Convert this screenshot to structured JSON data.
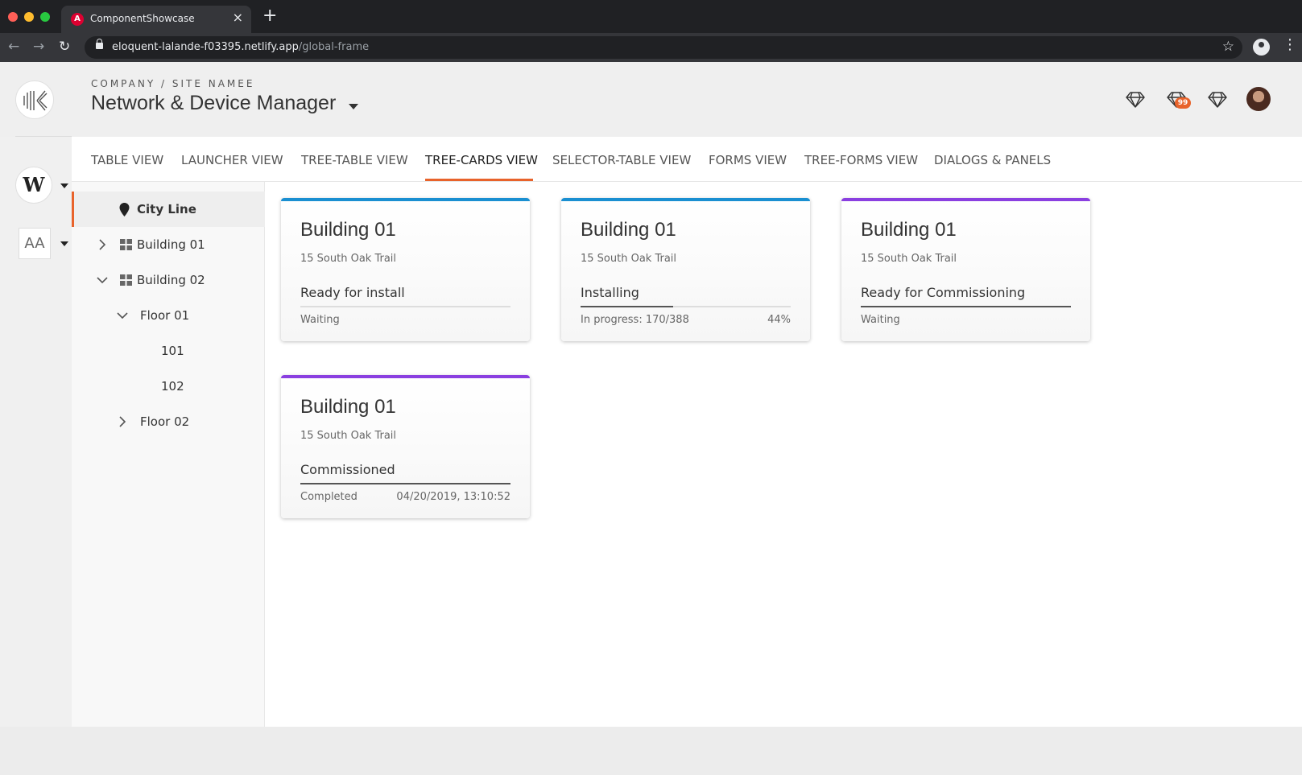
{
  "browser": {
    "tab_title": "ComponentShowcase",
    "url_host": "eloquent-lalande-f03395.netlify.app",
    "url_path": "/global-frame"
  },
  "header": {
    "breadcrumb": "COMPANY / SITE NAMEE",
    "title": "Network & Device Manager",
    "notification_count": "99"
  },
  "rail": {
    "workspace_letter": "W",
    "font_size_label": "AA"
  },
  "tabs": [
    {
      "label": "TABLE VIEW"
    },
    {
      "label": "LAUNCHER VIEW"
    },
    {
      "label": "TREE-TABLE VIEW"
    },
    {
      "label": "TREE-CARDS VIEW",
      "active": true
    },
    {
      "label": "SELECTOR-TABLE VIEW"
    },
    {
      "label": "FORMS VIEW"
    },
    {
      "label": "TREE-FORMS VIEW"
    },
    {
      "label": "DIALOGS & PANELS"
    }
  ],
  "tree": [
    {
      "label": "City Line",
      "selected": true
    },
    {
      "label": "Building 01",
      "expanded": false
    },
    {
      "label": "Building 02",
      "expanded": true
    },
    {
      "label": "Floor 01",
      "expanded": true
    },
    {
      "label": "101"
    },
    {
      "label": "102"
    },
    {
      "label": "Floor 02",
      "expanded": false
    }
  ],
  "cards": [
    {
      "title": "Building 01",
      "address": "15 South Oak Trail",
      "status": "Ready for install",
      "detail": "Waiting",
      "detail_right": "",
      "accent": "#1a8fd1",
      "progress": 0
    },
    {
      "title": "Building 01",
      "address": "15 South Oak Trail",
      "status": "Installing",
      "detail": "In progress: 170/388",
      "detail_right": "44%",
      "accent": "#1a8fd1",
      "progress": 0.44
    },
    {
      "title": "Building 01",
      "address": "15 South Oak Trail",
      "status": "Ready for Commissioning",
      "detail": "Waiting",
      "detail_right": "",
      "accent": "#8a3fe0",
      "progress": 1.0
    },
    {
      "title": "Building 01",
      "address": "15 South Oak Trail",
      "status": "Commissioned",
      "detail": "Completed",
      "detail_right": "04/20/2019, 13:10:52",
      "accent": "#8a3fe0",
      "progress": 1.0
    }
  ],
  "colors": {
    "accent_orange": "#e8632b",
    "blue": "#1a8fd1",
    "purple": "#8a3fe0"
  }
}
